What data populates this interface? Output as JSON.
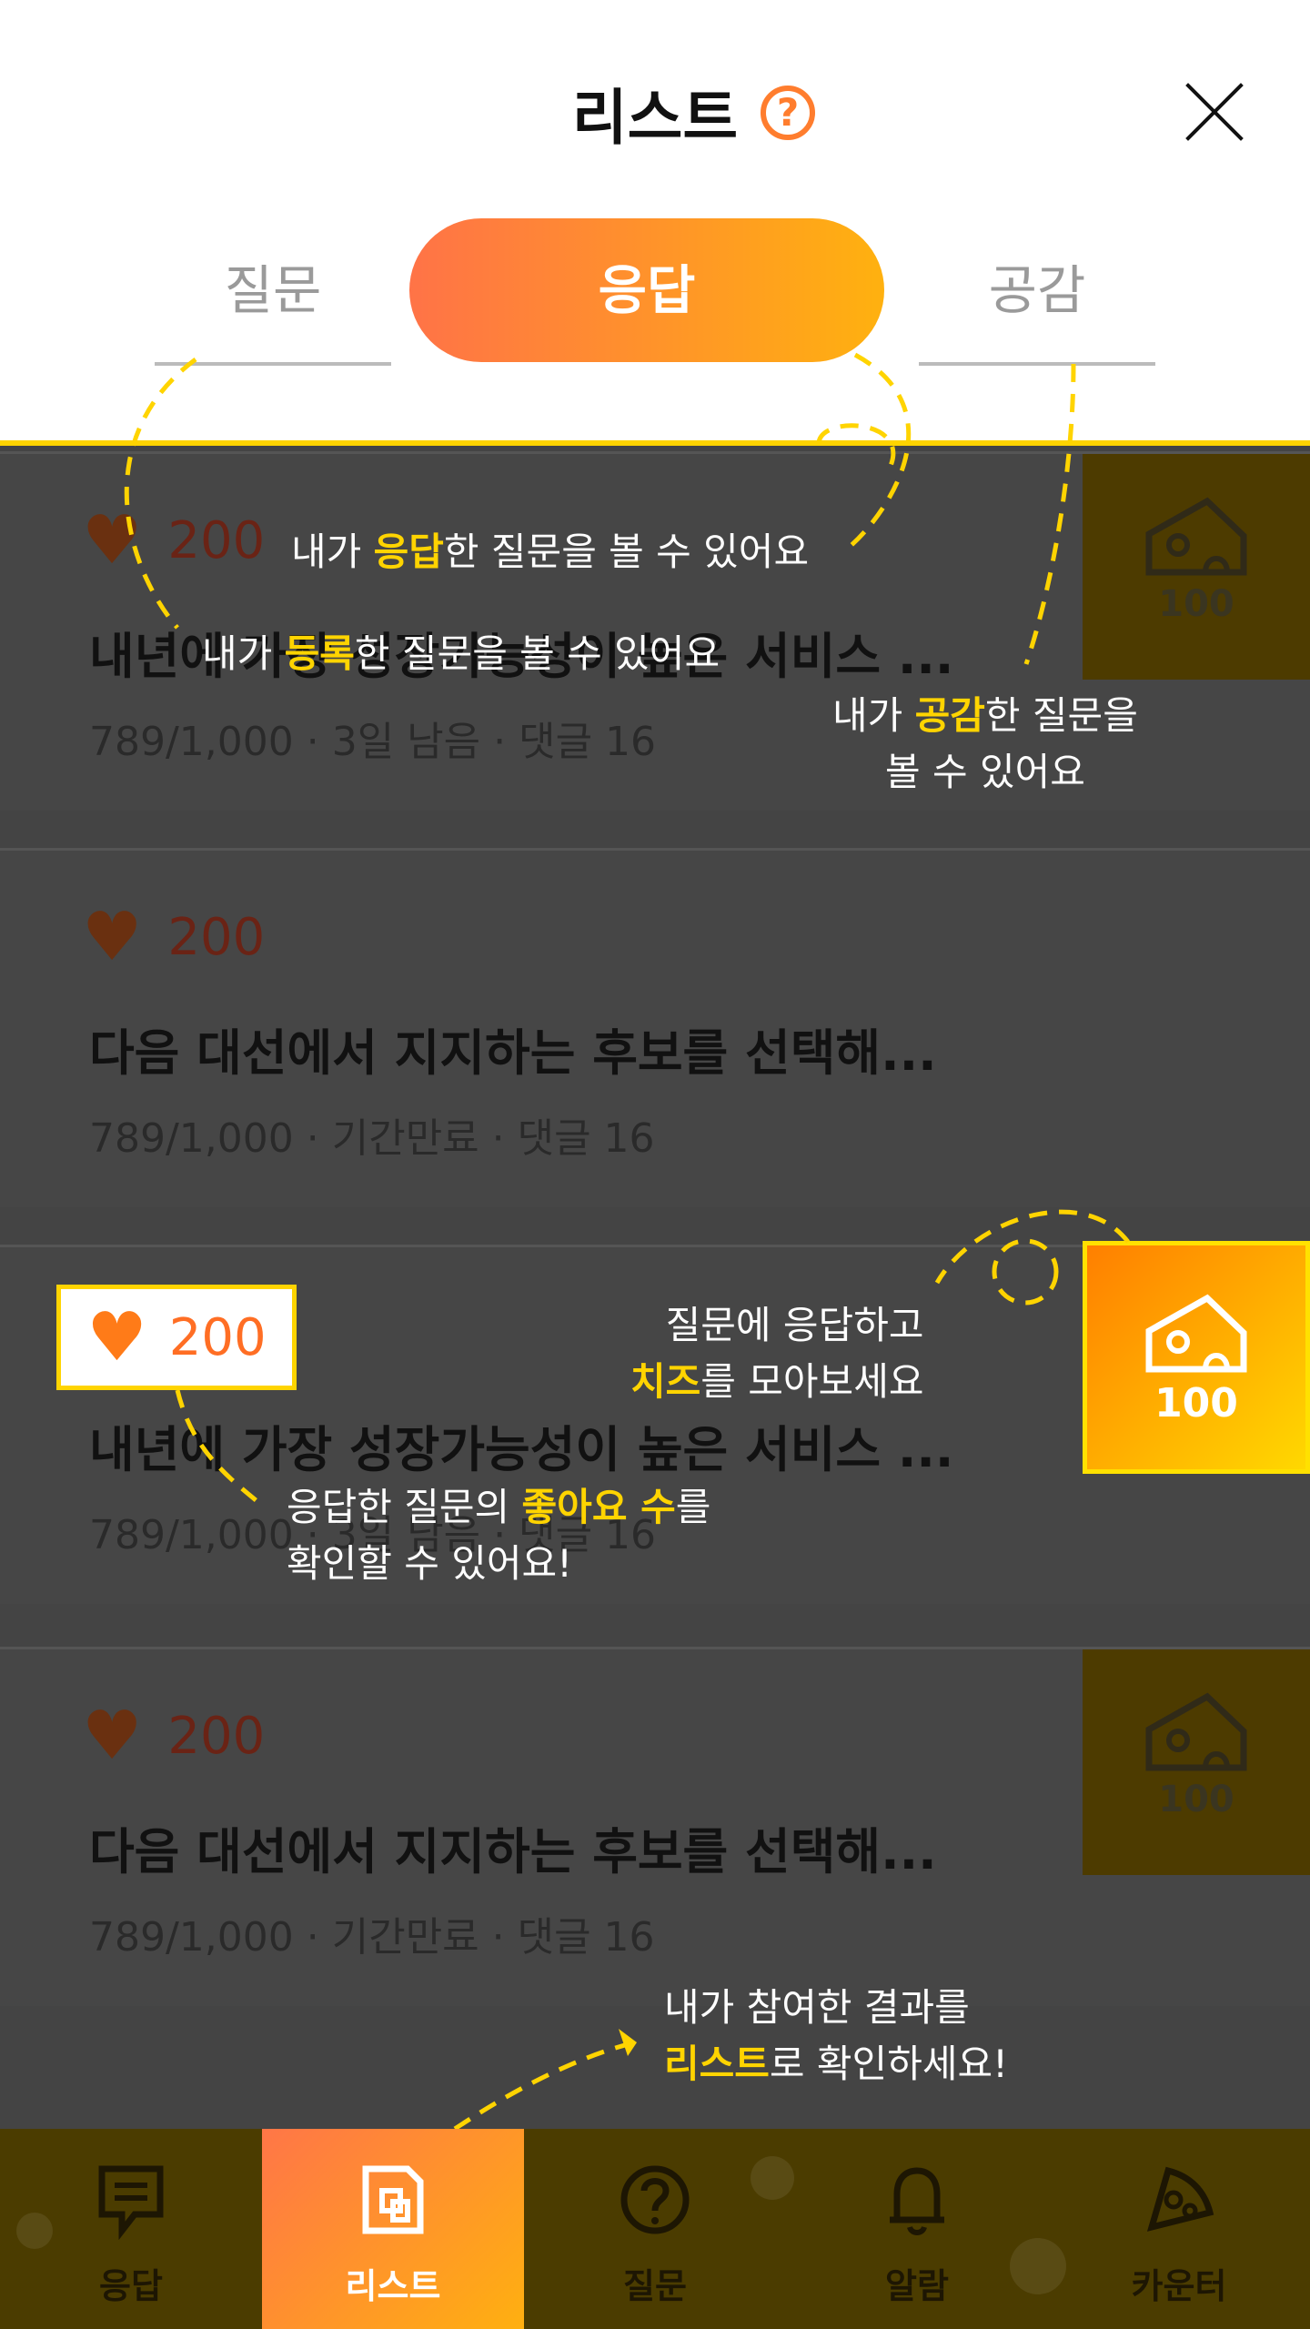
{
  "header": {
    "title": "리스트",
    "help_icon": "?"
  },
  "tabs": [
    {
      "label": "질문"
    },
    {
      "label": "응답"
    },
    {
      "label": "공감"
    }
  ],
  "cards": [
    {
      "likes": "200",
      "title": "내년에 가장 성장가능성이 높은 서비스 ...",
      "meta": "789/1,000 · 3일 남음 · 댓글 16",
      "badge": "100"
    },
    {
      "likes": "200",
      "title": "다음 대선에서 지지하는 후보를 선택해...",
      "meta": "789/1,000 · 기간만료 · 댓글 16"
    },
    {
      "likes": "200",
      "title": "내년에 가장 성장가능성이 높은 서비스 ...",
      "meta": "789/1,000 · 3일 남음 · 댓글 16",
      "badge": "100"
    },
    {
      "likes": "200",
      "title": "다음 대선에서 지지하는 후보를 선택해...",
      "meta": "789/1,000 · 기간만료 · 댓글 16",
      "badge": "100"
    }
  ],
  "tips": {
    "response_pre": "내가 ",
    "response_hl": "응답",
    "response_post": "한 질문을 볼 수 있어요",
    "question_pre": "내가 ",
    "question_hl": "등록",
    "question_post": "한 질문을 볼 수 있어요",
    "empathy_pre": "내가 ",
    "empathy_hl": "공감",
    "empathy_post": "한 질문을",
    "empathy_line2": "볼 수 있어요",
    "cheese_line1": "질문에 응답하고",
    "cheese_hl": "치즈",
    "cheese_post": "를 모아보세요",
    "likes_pre": "응답한 질문의 ",
    "likes_hl": "좋아요 수",
    "likes_post": "를",
    "likes_line2": "확인할 수 있어요!",
    "list_line1": "내가 참여한 결과를",
    "list_hl": "리스트",
    "list_post": "로 확인하세요!"
  },
  "featured": {
    "likes": "200",
    "badge": "100"
  },
  "bottom_nav": [
    {
      "label": "응답"
    },
    {
      "label": "리스트"
    },
    {
      "label": "질문"
    },
    {
      "label": "알람"
    },
    {
      "label": "카운터"
    }
  ]
}
